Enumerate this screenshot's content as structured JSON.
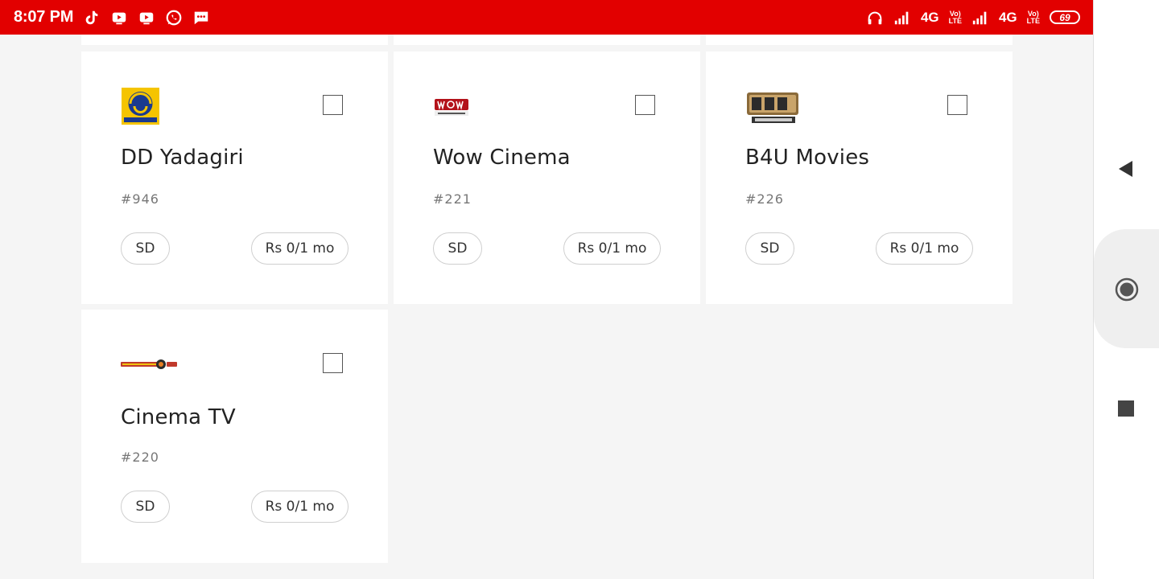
{
  "status_bar": {
    "time": "8:07 PM",
    "network1": "4G",
    "network2": "4G",
    "volte1": [
      "Vo)",
      "LTE"
    ],
    "volte2": [
      "Vo)",
      "LTE"
    ],
    "battery": "69",
    "color": "#e20000"
  },
  "channels": [
    {
      "name": "DD Yadagiri",
      "number": "#946",
      "quality": "SD",
      "price": "Rs 0/1 mo",
      "logo": "dd-yadagiri-logo"
    },
    {
      "name": "Wow Cinema",
      "number": "#221",
      "quality": "SD",
      "price": "Rs 0/1 mo",
      "logo": "wow-cinema-logo"
    },
    {
      "name": "B4U Movies",
      "number": "#226",
      "quality": "SD",
      "price": "Rs 0/1 mo",
      "logo": "b4u-movies-logo"
    },
    {
      "name": "Cinema TV",
      "number": "#220",
      "quality": "SD",
      "price": "Rs 0/1 mo",
      "logo": "cinema-tv-logo"
    }
  ],
  "navigation": {
    "back": "back-triangle-icon",
    "home": "home-circle-icon",
    "recents": "recents-square-icon"
  }
}
